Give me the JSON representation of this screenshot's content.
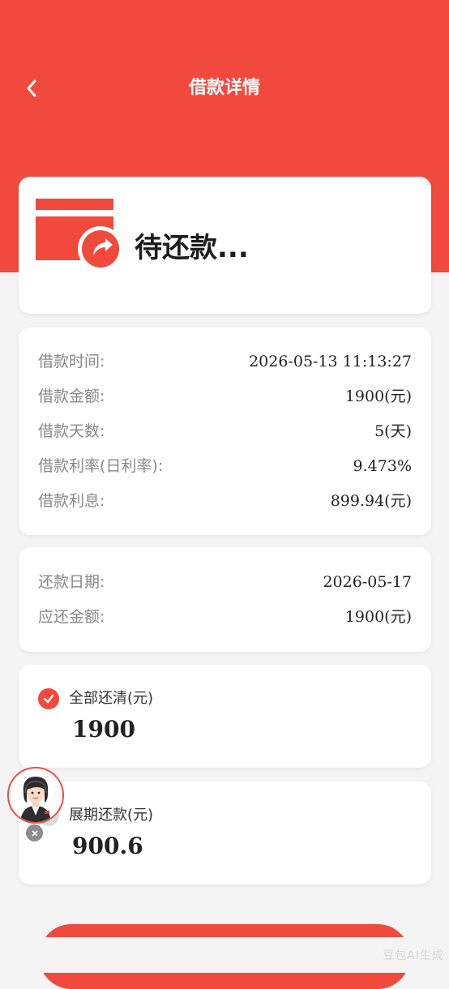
{
  "header": {
    "title": "借款详情"
  },
  "status": {
    "text": "待还款..."
  },
  "loan_info": {
    "rows": [
      {
        "label": "借款时间:",
        "value": "2026-05-13 11:13:27"
      },
      {
        "label": "借款金额:",
        "value": "1900(元)"
      },
      {
        "label": "借款天数:",
        "value": "5(天)"
      },
      {
        "label": "借款利率(日利率):",
        "value": "9.473%"
      },
      {
        "label": "借款利息:",
        "value": "899.94(元)"
      }
    ]
  },
  "repay_info": {
    "rows": [
      {
        "label": "还款日期:",
        "value": "2026-05-17"
      },
      {
        "label": "应还金额:",
        "value": "1900(元)"
      }
    ]
  },
  "options": [
    {
      "label": "全部还清(元)",
      "amount": "1900",
      "selected": true
    },
    {
      "label": "展期还款(元)",
      "amount": "900.6",
      "selected": false
    }
  ],
  "watermark": "豆包AI生成",
  "colors": {
    "accent": "#f2493d",
    "background": "#f4f4f4"
  },
  "icons": [
    "back-arrow-icon",
    "card-refresh-icon",
    "check-icon",
    "customer-service-avatar",
    "close-icon"
  ]
}
